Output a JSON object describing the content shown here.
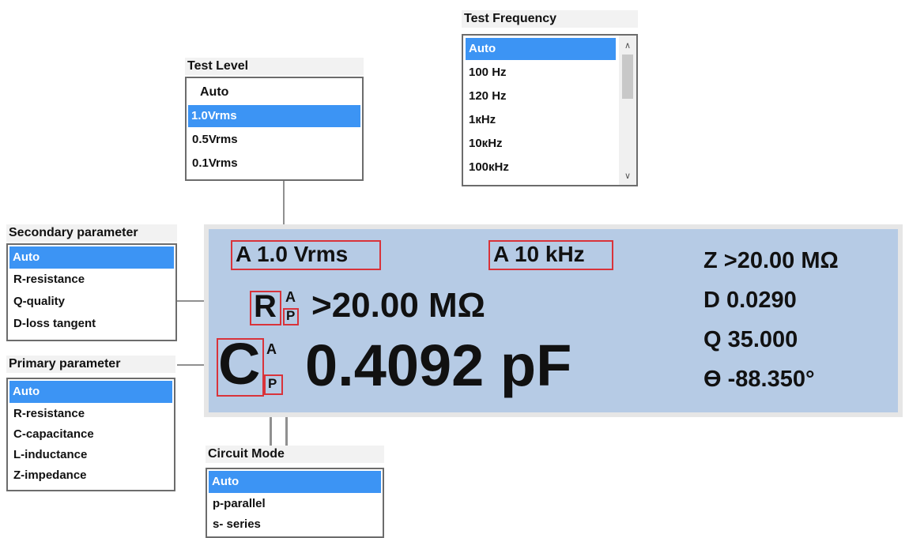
{
  "test_frequency": {
    "title": "Test Frequency",
    "options": [
      "Auto",
      "100 Hz",
      "120 Hz",
      "1кHz",
      "10кHz",
      "100кHz"
    ],
    "selected": "Auto",
    "scroll_up": "∧",
    "scroll_down": "∨"
  },
  "test_level": {
    "title": "Test Level",
    "options": [
      "Auto",
      "1.0Vrms",
      "0.5Vrms",
      "0.1Vrms"
    ],
    "selected": "1.0Vrms"
  },
  "secondary_parameter": {
    "title": "Secondary parameter",
    "options": [
      "Auto",
      "R-resistance",
      "Q-quality",
      "D-loss tangent"
    ],
    "selected": "Auto"
  },
  "primary_parameter": {
    "title": "Primary parameter",
    "options": [
      "Auto",
      "R-resistance",
      "C-capacitance",
      "L-inductance",
      "Z-impedance"
    ],
    "selected": "Auto"
  },
  "circuit_mode": {
    "title": "Circuit Mode",
    "options": [
      "Auto",
      "p-parallel",
      "s- series"
    ],
    "selected": "Auto"
  },
  "display": {
    "level_readout": "A 1.0 Vrms",
    "frequency_readout": "A 10 kHz",
    "secondary": {
      "symbol": "R",
      "mode_auto": "A",
      "mode_circuit": "P",
      "value": ">20.00 MΩ"
    },
    "primary": {
      "symbol": "C",
      "mode_auto": "A",
      "mode_circuit": "P",
      "value": "0.4092 pF"
    },
    "readouts": {
      "z": "Z >20.00 MΩ",
      "d": "D 0.0290",
      "q": "Q 35.000",
      "theta": "ϴ -88.350°"
    }
  },
  "colors": {
    "display_bg": "#b6cbe5",
    "selection": "#3c94f4",
    "highlight_box": "#d9333a"
  }
}
